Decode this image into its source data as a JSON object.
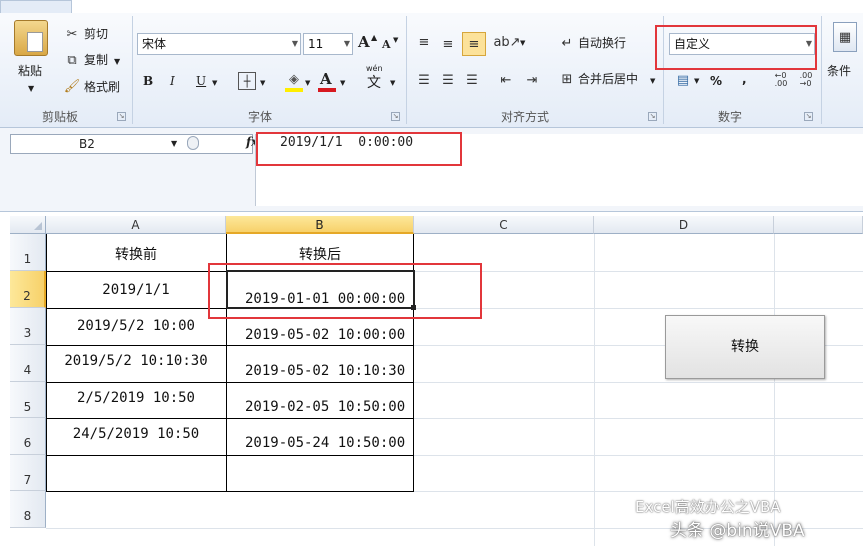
{
  "ribbon": {
    "clipboard": {
      "paste_label": "粘贴",
      "cut_label": "剪切",
      "copy_label": "复制",
      "format_painter_label": "格式刷",
      "group_label": "剪贴板"
    },
    "font": {
      "font_name": "宋体",
      "font_size": "11",
      "grow_label": "A",
      "shrink_label": "A",
      "bold_label": "B",
      "italic_label": "I",
      "underline_label": "U",
      "font_color_letter": "A",
      "phonetic_label": "wén",
      "phonetic_char": "文",
      "group_label": "字体"
    },
    "alignment": {
      "wrap_text_label": "自动换行",
      "merge_center_label": "合并后居中",
      "group_label": "对齐方式"
    },
    "number": {
      "format_value": "自定义",
      "percent_label": "%",
      "comma_label": ",",
      "group_label": "数字"
    },
    "styles": {
      "conditional_label": "条件"
    }
  },
  "formula_bar": {
    "name_box": "B2",
    "fx_label": "fx",
    "content": "2019/1/1  0:00:00"
  },
  "sheet": {
    "columns": [
      "A",
      "B",
      "C",
      "D"
    ],
    "rows": [
      "1",
      "2",
      "3",
      "4",
      "5",
      "6",
      "7",
      "8"
    ],
    "headers": {
      "before": "转换前",
      "after": "转换后"
    },
    "cells_a": [
      "2019/1/1",
      "2019/5/2 10:00",
      "2019/5/2 10:10:30",
      "2/5/2019 10:50",
      "24/5/2019 10:50"
    ],
    "cells_b": [
      "2019-01-01 00:00:00",
      "2019-05-02 10:00:00",
      "2019-05-02 10:10:30",
      "2019-02-05 10:50:00",
      "2019-05-24 10:50:00"
    ]
  },
  "convert_button": "转换",
  "watermark": {
    "line1": "Excel高效办公之VBA",
    "line2": "头条 @bin说VBA"
  },
  "colors": {
    "highlight_red": "#e2363b",
    "selected_header": "#f7d16a"
  }
}
